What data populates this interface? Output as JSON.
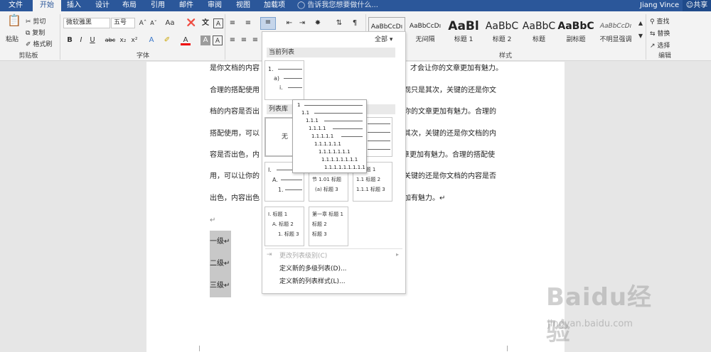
{
  "menu": {
    "tabs": [
      "文件",
      "开始",
      "插入",
      "设计",
      "布局",
      "引用",
      "邮件",
      "审阅",
      "视图",
      "加载项"
    ],
    "active_tab": "开始",
    "tell_me": "告诉我您想要做什么...",
    "user": "Jiang Vince",
    "share": "共享"
  },
  "ribbon": {
    "clipboard": {
      "label": "剪贴板",
      "paste": "粘贴",
      "cut": "剪切",
      "copy": "复制",
      "format_painter": "格式刷"
    },
    "font": {
      "label": "字体",
      "font_name": "微软雅黑",
      "font_size": "五号",
      "aa": "Aa",
      "bold": "B",
      "italic": "I",
      "underline": "U",
      "strike": "abc",
      "sub": "x₂",
      "sup": "x²",
      "font_color": "A",
      "char_shade": "A"
    },
    "styles": {
      "label": "样式",
      "items": [
        {
          "sample": "AaBbCcDı",
          "name": "正文"
        },
        {
          "sample": "AaBbCcDı",
          "name": "无间隔"
        },
        {
          "sample": "AaBl",
          "name": "标题 1"
        },
        {
          "sample": "AaBbC",
          "name": "标题 2"
        },
        {
          "sample": "AaBbC",
          "name": "标题"
        },
        {
          "sample": "AaBbC",
          "name": "副标题"
        },
        {
          "sample": "AaBbCcDı",
          "name": "不明显强调"
        }
      ]
    },
    "editing": {
      "label": "编辑",
      "find": "查找",
      "replace": "替换",
      "select": "选择"
    }
  },
  "document": {
    "lines": [
      "是你文档的内容",
      "才会让你的文章更加有魅力。",
      "合理的搭配使用",
      "观只是其次，关键的还是你文",
      "档的内容是否出",
      "你的文章更加有魅力。合理的",
      "搭配使用，可以",
      "其次，关键的还是你文档的内",
      "容是否出色，内",
      "文章更加有魅力。合理的搭配使",
      "用，可以让你的",
      "关键的还是你文档的内容是否",
      "出色，内容出色",
      "加有魅力。↵"
    ],
    "para_mark": "↵",
    "levels": [
      "一级↵",
      "二级↵",
      "三级↵"
    ]
  },
  "dropdown": {
    "filter": "全部",
    "current_list_header": "当前列表",
    "library_header": "列表库",
    "none_label": "无",
    "current_tile": [
      "1.",
      "a)",
      "i."
    ],
    "tiles": {
      "t2": [
        "1.",
        "1.1.",
        "1.1.1."
      ],
      "t3": [
        "1)",
        "a)",
        "i)"
      ],
      "t4": [
        "I.",
        "A.",
        "1."
      ],
      "t5": [
        "节 1.01 标题",
        "(a) 标题 3"
      ],
      "t6": [
        "1 标题 1",
        "1.1 标题 2",
        "1.1.1 标题 3"
      ],
      "t7": [
        "I. 标题 1",
        "A. 标题 2",
        "1. 标题 3"
      ],
      "t8": [
        "第一章 标题 1",
        "标题 2",
        "标题 3"
      ]
    },
    "change_level": "更改列表级别(C)",
    "define_list": "定义新的多级列表(D)...",
    "define_style": "定义新的列表样式(L)..."
  },
  "preview": {
    "levels": [
      "1",
      "1.1",
      "1.1.1",
      "1.1.1.1",
      "1.1.1.1.1",
      "1.1.1.1.1.1",
      "1.1.1.1.1.1.1",
      "1.1.1.1.1.1.1.1",
      "1.1.1.1.1.1.1.1.1"
    ]
  },
  "watermark": {
    "logo": "Baidu经验",
    "url": "jingyan.baidu.com"
  }
}
